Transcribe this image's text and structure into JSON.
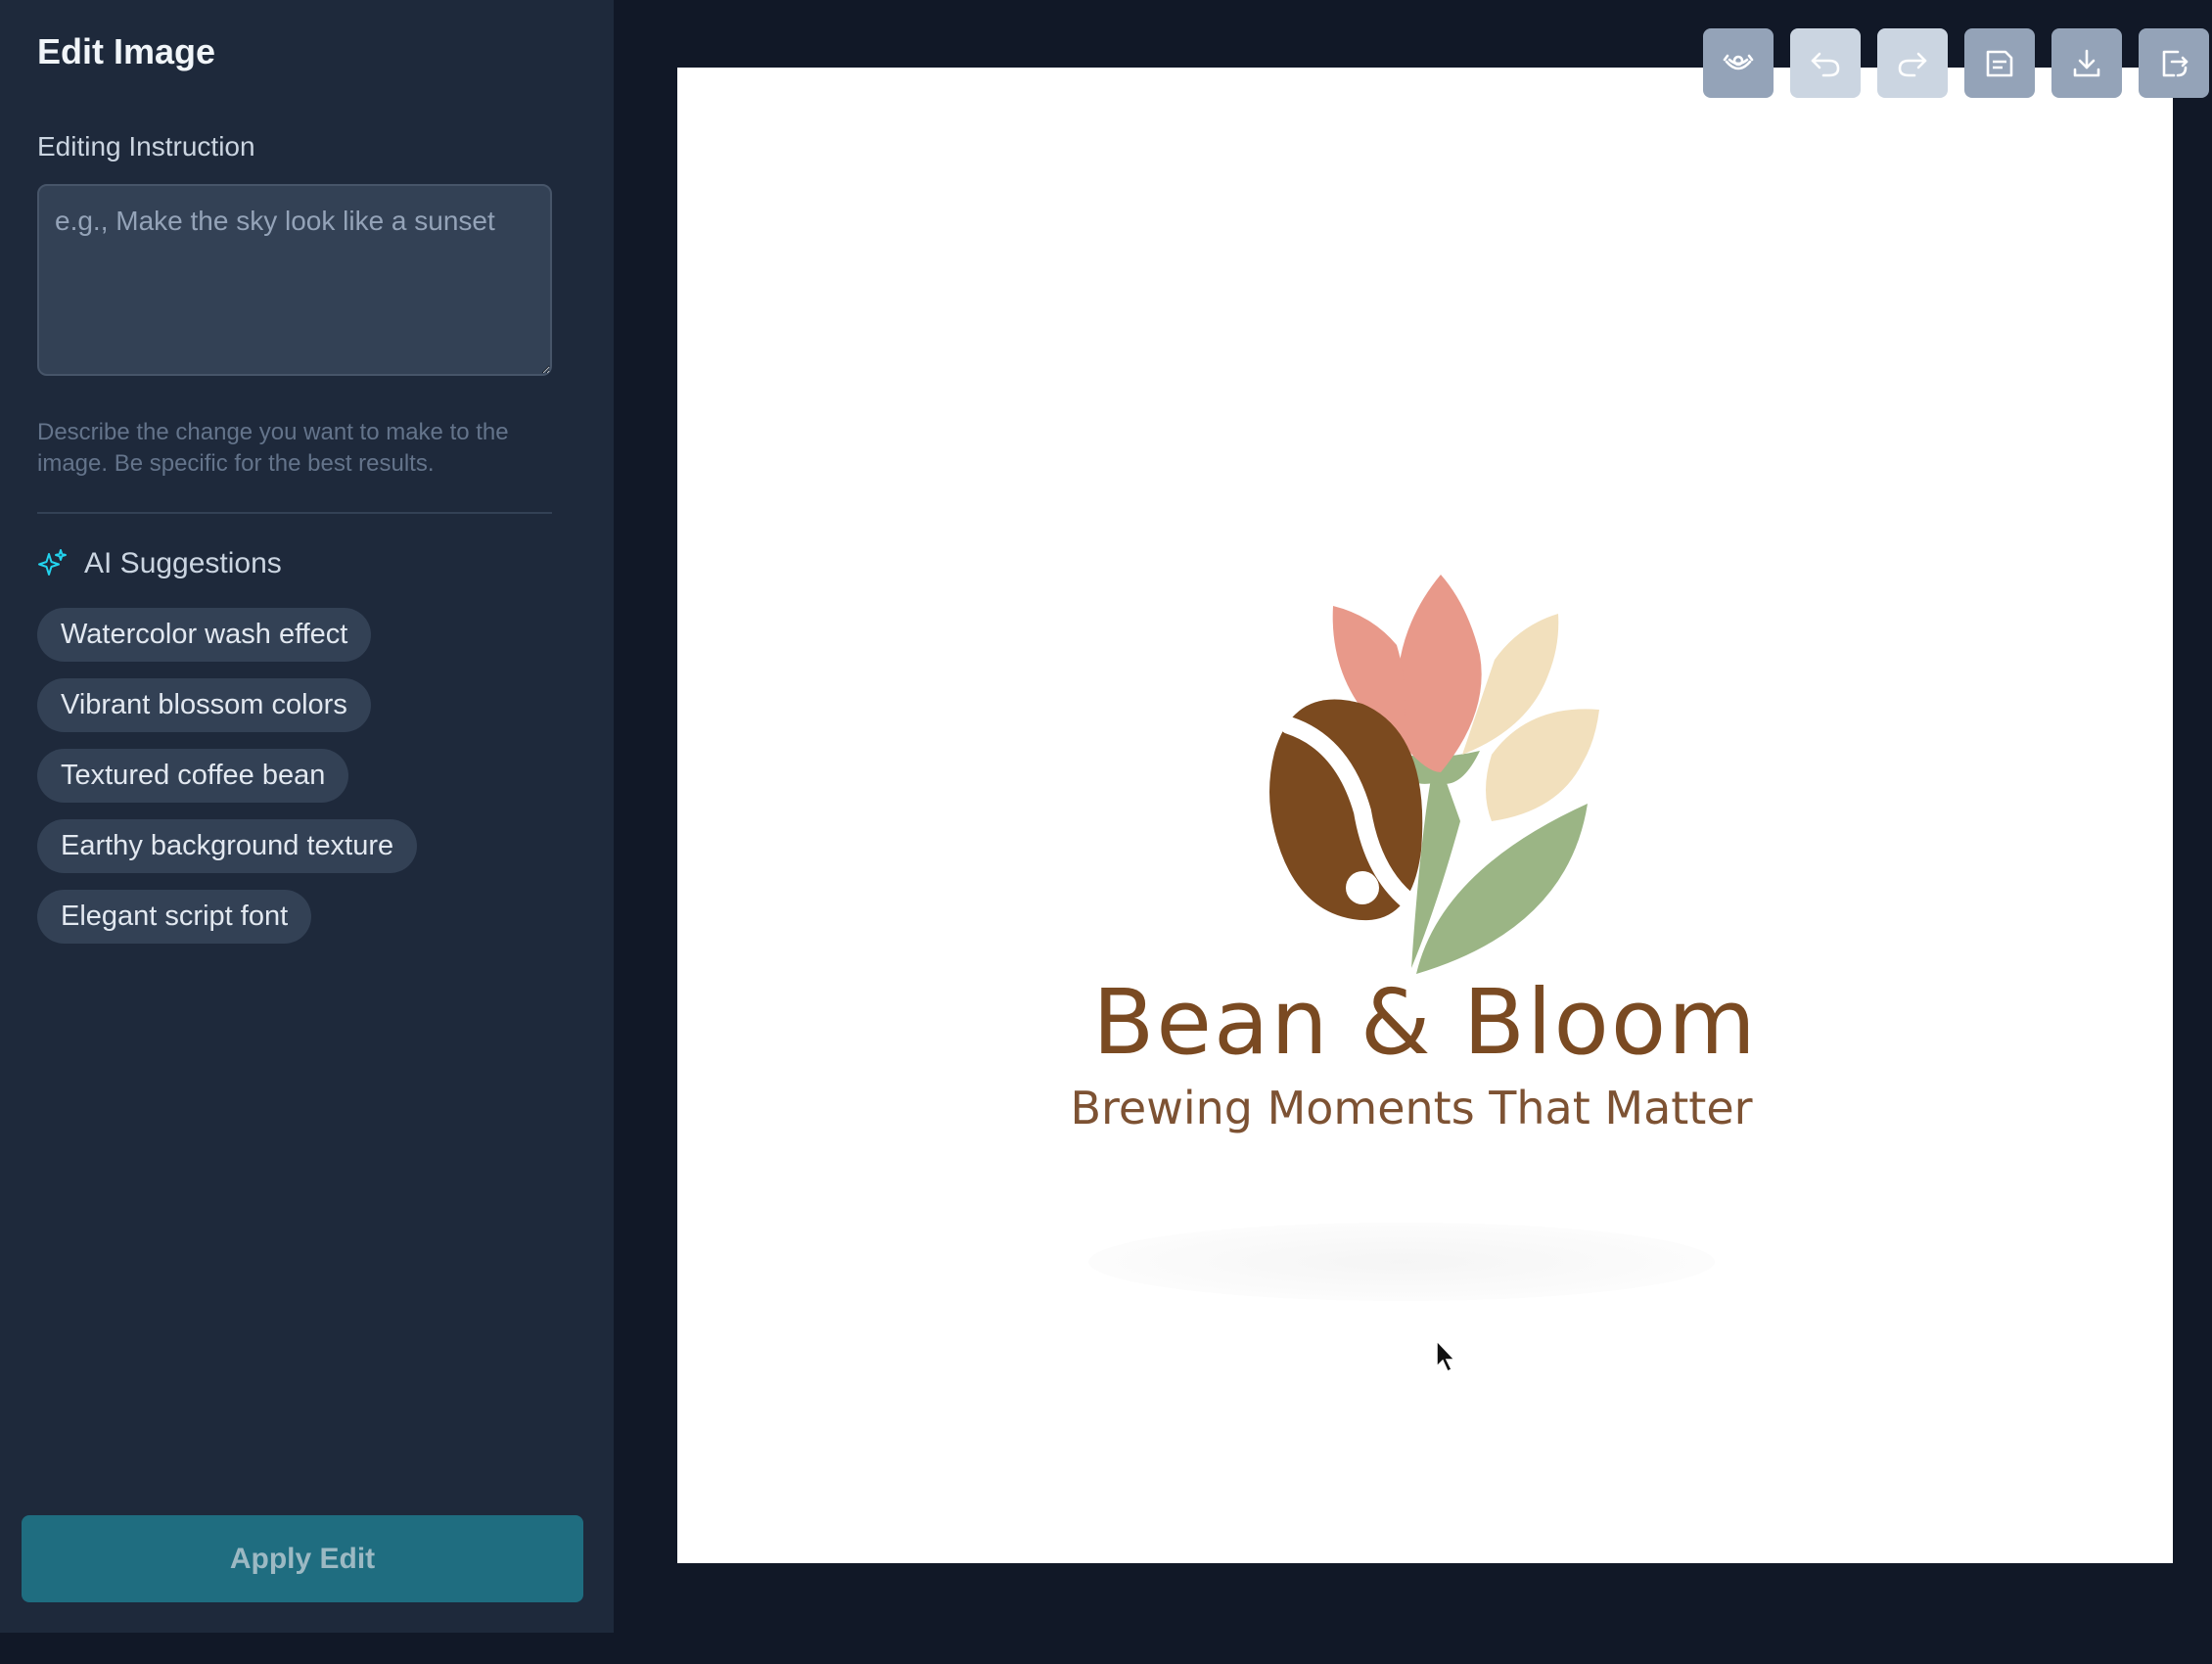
{
  "sidebar": {
    "title": "Edit Image",
    "instruction_label": "Editing Instruction",
    "instruction_placeholder": "e.g., Make the sky look like a sunset",
    "instruction_value": "",
    "help_text": "Describe the change you want to make to the image. Be specific for the best results.",
    "suggestions_heading": "AI Suggestions",
    "suggestions": [
      "Watercolor wash effect",
      "Vibrant blossom colors",
      "Textured coffee bean",
      "Earthy background texture",
      "Elegant script font"
    ],
    "apply_label": "Apply Edit"
  },
  "toolbar": {
    "buttons": [
      "compare-icon",
      "undo-icon",
      "redo-icon",
      "save-icon",
      "download-icon",
      "replace-icon"
    ]
  },
  "canvas": {
    "brand_name": "Bean & Bloom",
    "tagline": "Brewing Moments That Matter"
  },
  "colors": {
    "sidebar_bg": "#1e293b",
    "page_bg": "#111827",
    "accent": "#1f6d80",
    "petal_pink": "#e8998a",
    "petal_cream": "#f2e0bd",
    "leaf_green": "#9bb585",
    "bean_brown": "#7b4a1f"
  }
}
